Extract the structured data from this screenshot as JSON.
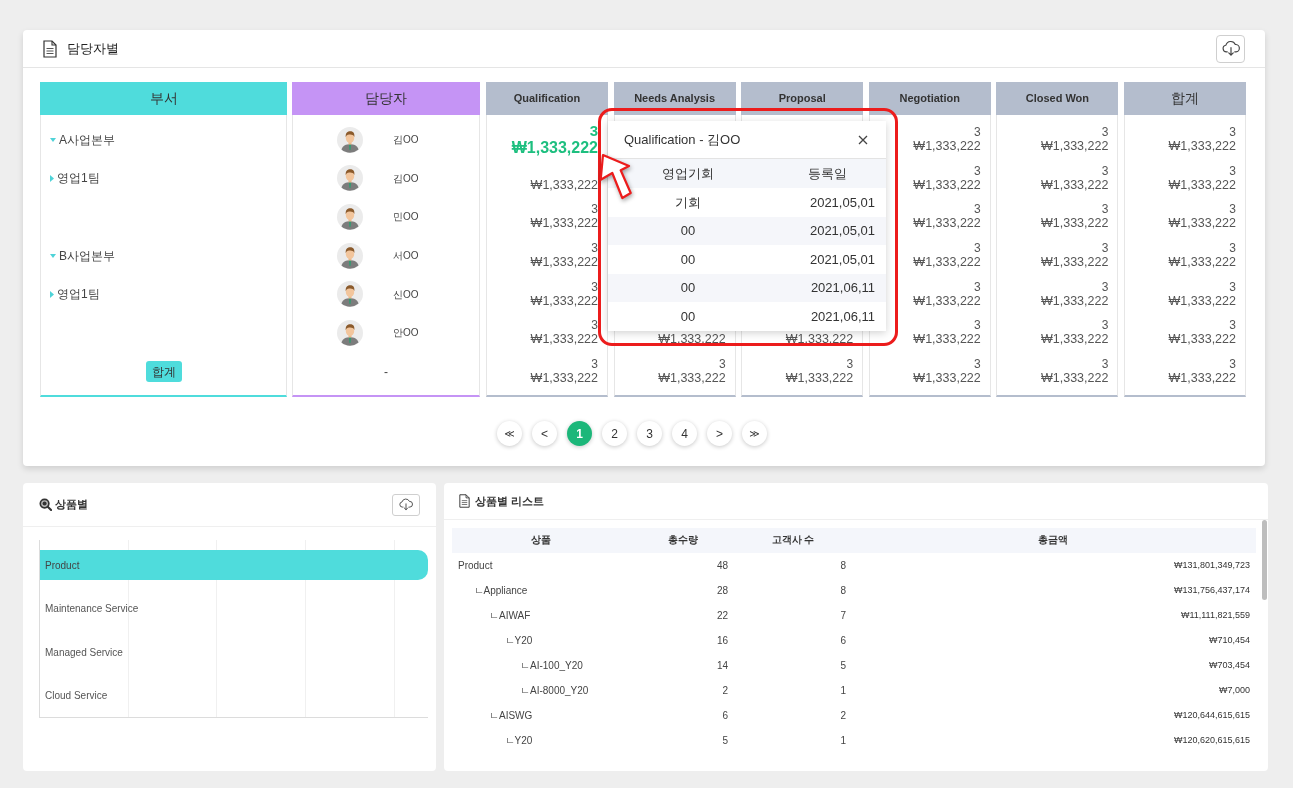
{
  "owner_panel": {
    "title": "담당자별",
    "department_column": {
      "header": "부서",
      "items": [
        {
          "label": "A사업본부",
          "expanded": true,
          "children": [
            {
              "label": "영업1팀",
              "expanded": false
            }
          ]
        },
        {
          "label": "B사업본부",
          "expanded": true,
          "children": [
            {
              "label": "영업1팀",
              "expanded": false
            }
          ]
        }
      ],
      "total": "합계"
    },
    "owner_column": {
      "header": "담당자",
      "items": [
        {
          "name": "김OO"
        },
        {
          "name": "김OO"
        },
        {
          "name": "민OO"
        },
        {
          "name": "서OO"
        },
        {
          "name": "신OO"
        },
        {
          "name": "안OO"
        }
      ],
      "total": "-"
    },
    "stage_columns": [
      {
        "header": "Qualification",
        "kind": "stage",
        "cells": [
          {
            "count": "3",
            "amount": "₩1,333,222",
            "selected": true
          },
          {
            "amount": "₩1,333,222",
            "selected": false
          },
          {
            "count": "3",
            "amount": "₩1,333,222",
            "selected": false
          },
          {
            "count": "3",
            "amount": "₩1,333,222",
            "selected": false
          },
          {
            "count": "3",
            "amount": "₩1,333,222",
            "selected": false
          },
          {
            "count": "3",
            "amount": "₩1,333,222",
            "selected": false
          },
          {
            "count": "3",
            "amount": "₩1,333,222",
            "selected": false
          }
        ]
      },
      {
        "header": "Needs Analysis",
        "kind": "stage",
        "cells": [
          {
            "amount": "₩1,333,222",
            "selected": false
          },
          {
            "count": "3",
            "amount": "₩1,333,222",
            "selected": false
          }
        ]
      },
      {
        "header": "Proposal",
        "kind": "stage",
        "cells": [
          {
            "amount": "₩1,333,222",
            "selected": false
          },
          {
            "count": "3",
            "amount": "₩1,333,222",
            "selected": false
          }
        ]
      },
      {
        "header": "Negotiation",
        "kind": "stage",
        "cells": [
          {
            "count": "3",
            "amount": "₩1,333,222",
            "selected": false
          },
          {
            "count": "3",
            "amount": "₩1,333,222",
            "selected": false
          },
          {
            "count": "3",
            "amount": "₩1,333,222",
            "selected": false
          },
          {
            "count": "3",
            "amount": "₩1,333,222",
            "selected": false
          },
          {
            "count": "3",
            "amount": "₩1,333,222",
            "selected": false
          },
          {
            "count": "3",
            "amount": "₩1,333,222",
            "selected": false
          },
          {
            "count": "3",
            "amount": "₩1,333,222",
            "selected": false
          }
        ]
      },
      {
        "header": "Closed Won",
        "kind": "stage",
        "cells": [
          {
            "count": "3",
            "amount": "₩1,333,222",
            "selected": false
          },
          {
            "count": "3",
            "amount": "₩1,333,222",
            "selected": false
          },
          {
            "count": "3",
            "amount": "₩1,333,222",
            "selected": false
          },
          {
            "count": "3",
            "amount": "₩1,333,222",
            "selected": false
          },
          {
            "count": "3",
            "amount": "₩1,333,222",
            "selected": false
          },
          {
            "count": "3",
            "amount": "₩1,333,222",
            "selected": false
          },
          {
            "count": "3",
            "amount": "₩1,333,222",
            "selected": false
          }
        ]
      },
      {
        "header": "합계",
        "kind": "total",
        "cells": [
          {
            "count": "3",
            "amount": "₩1,333,222",
            "selected": false
          },
          {
            "count": "3",
            "amount": "₩1,333,222",
            "selected": false
          },
          {
            "count": "3",
            "amount": "₩1,333,222",
            "selected": false
          },
          {
            "count": "3",
            "amount": "₩1,333,222",
            "selected": false
          },
          {
            "count": "3",
            "amount": "₩1,333,222",
            "selected": false
          },
          {
            "count": "3",
            "amount": "₩1,333,222",
            "selected": false
          },
          {
            "count": "3",
            "amount": "₩1,333,222",
            "selected": false
          }
        ]
      }
    ],
    "pagination": [
      {
        "label": "≪",
        "kind": "first",
        "selected": false
      },
      {
        "label": "<",
        "kind": "prev",
        "selected": false
      },
      {
        "label": "1",
        "kind": "page",
        "selected": true
      },
      {
        "label": "2",
        "kind": "page",
        "selected": false
      },
      {
        "label": "3",
        "kind": "page",
        "selected": false
      },
      {
        "label": "4",
        "kind": "page",
        "selected": false
      },
      {
        "label": ">",
        "kind": "next",
        "selected": false
      },
      {
        "label": "≫",
        "kind": "last",
        "selected": false
      }
    ]
  },
  "detail_popup": {
    "title": "Qualification - 김OO",
    "columns": [
      "영업기회",
      "등록일"
    ],
    "rows": [
      {
        "opportunity": "기회",
        "registered": "2021,05,01"
      },
      {
        "opportunity": "00",
        "registered": "2021,05,01"
      },
      {
        "opportunity": "00",
        "registered": "2021,05,01"
      },
      {
        "opportunity": "00",
        "registered": "2021,06,11"
      },
      {
        "opportunity": "00",
        "registered": "2021,06,11"
      }
    ]
  },
  "product_panel": {
    "title": "상품별",
    "categories": [
      {
        "label": "Product",
        "selected": true
      },
      {
        "label": "Maintenance Service",
        "selected": false
      },
      {
        "label": "Managed Service",
        "selected": false
      },
      {
        "label": "Cloud Service",
        "selected": false
      }
    ]
  },
  "product_list_panel": {
    "title": "상품별 리스트",
    "columns": [
      "상품",
      "총수량",
      "고객사 수",
      "총금액"
    ],
    "rows": [
      {
        "name": "Product",
        "quantity": "48",
        "customers": "8",
        "total": "₩131,801,349,723",
        "children": [
          {
            "name": "ㄴAppliance",
            "quantity": "28",
            "customers": "8",
            "total": "₩131,756,437,174",
            "children": [
              {
                "name": "ㄴAIWAF",
                "quantity": "22",
                "customers": "7",
                "total": "₩11,111,821,559",
                "children": [
                  {
                    "name": "ㄴY20",
                    "quantity": "16",
                    "customers": "6",
                    "total": "₩710,454",
                    "children": [
                      {
                        "name": "ㄴAI-100_Y20",
                        "quantity": "14",
                        "customers": "5",
                        "total": "₩703,454"
                      },
                      {
                        "name": "ㄴAI-8000_Y20",
                        "quantity": "2",
                        "customers": "1",
                        "total": "₩7,000"
                      }
                    ]
                  }
                ]
              },
              {
                "name": "ㄴAISWG",
                "quantity": "6",
                "customers": "2",
                "total": "₩120,644,615,615",
                "children": [
                  {
                    "name": "ㄴY20",
                    "quantity": "5",
                    "customers": "1",
                    "total": "₩120,620,615,615"
                  }
                ]
              }
            ]
          }
        ]
      }
    ]
  }
}
